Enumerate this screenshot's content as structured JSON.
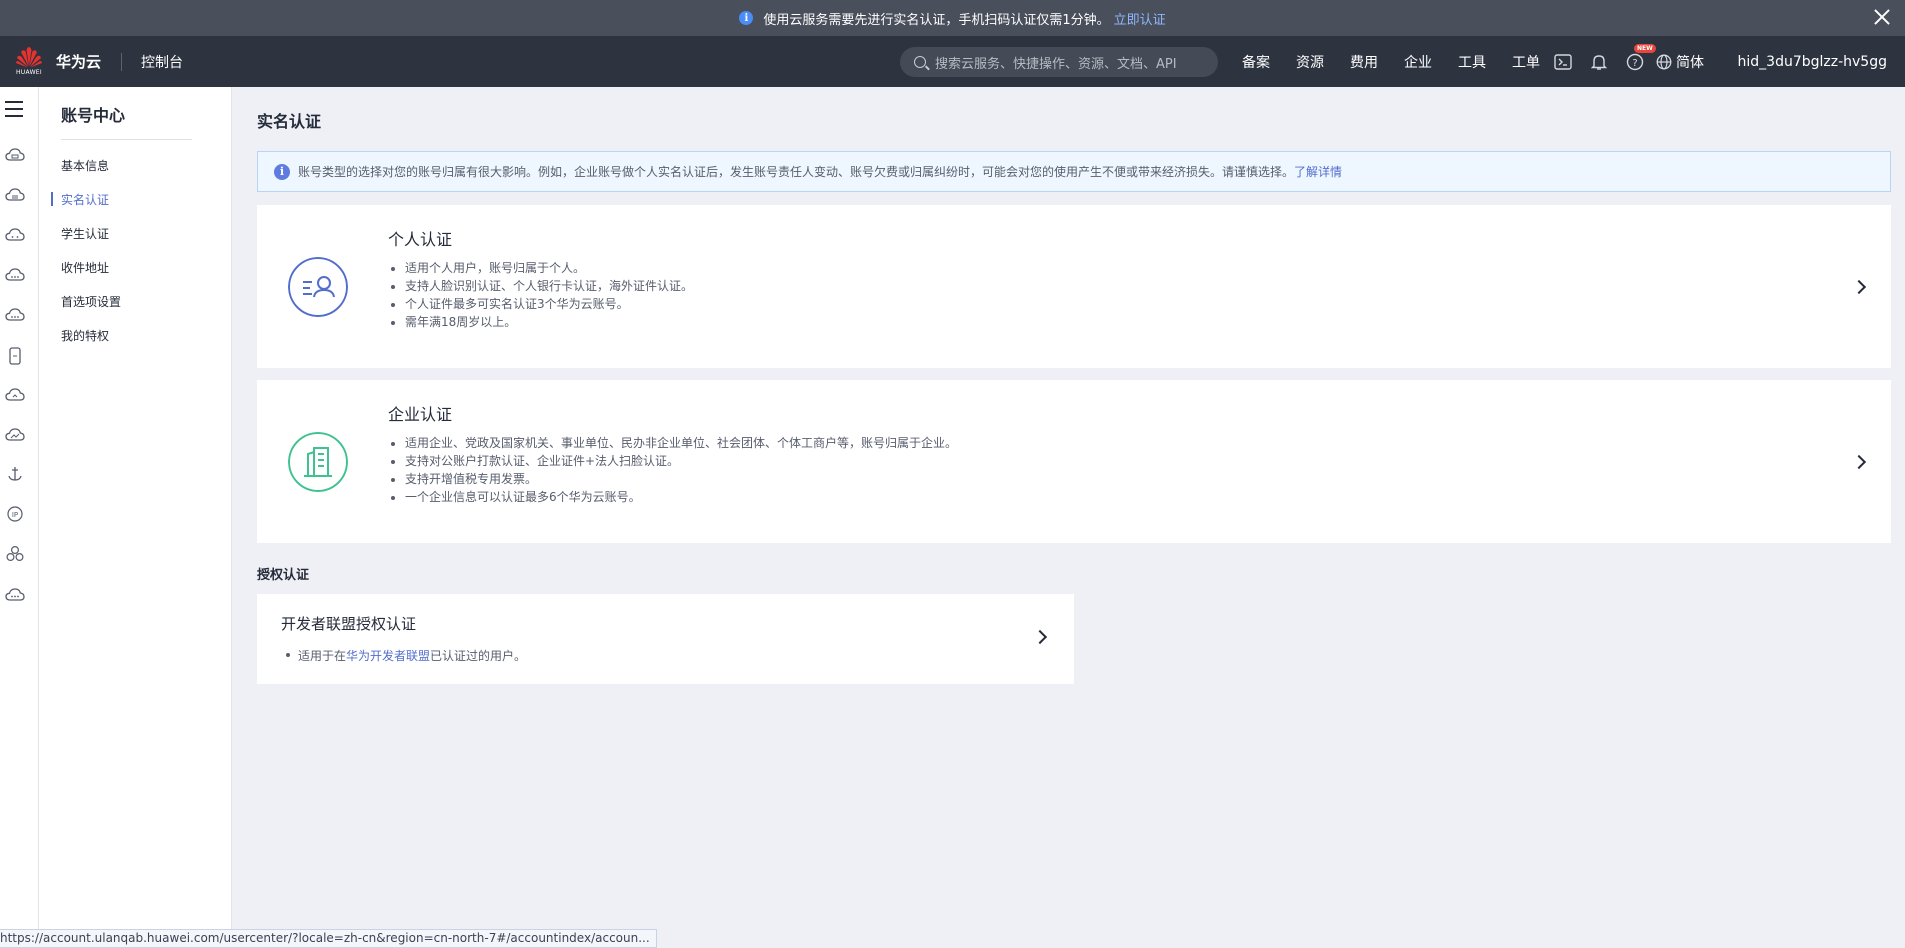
{
  "notice": {
    "text": "使用云服务需要先进行实名认证，手机扫码认证仅需1分钟。",
    "link": "立即认证"
  },
  "header": {
    "logo_text": "华为云",
    "logo_sub": "HUAWEI",
    "console": "控制台",
    "search_placeholder": "搜索云服务、快捷操作、资源、文档、API",
    "nav": [
      "备案",
      "资源",
      "费用",
      "企业",
      "工具",
      "工单"
    ],
    "new_badge": "NEW",
    "language": "简体",
    "user": "hid_3du7bglzz-hv5gg"
  },
  "menu": {
    "title": "账号中心",
    "items": [
      "基本信息",
      "实名认证",
      "学生认证",
      "收件地址",
      "首选项设置",
      "我的特权"
    ],
    "active_index": 1
  },
  "main": {
    "page_title": "实名认证",
    "alert_text": "账号类型的选择对您的账号归属有很大影响。例如，企业账号做个人实名认证后，发生账号责任人变动、账号欠费或归属纠纷时，可能会对您的使用产生不便或带来经济损失。请谨慎选择。",
    "alert_link": "了解详情",
    "personal": {
      "title": "个人认证",
      "bullets": [
        "适用个人用户，账号归属于个人。",
        "支持人脸识别认证、个人银行卡认证，海外证件认证。",
        "个人证件最多可实名认证3个华为云账号。",
        "需年满18周岁以上。"
      ],
      "icon_color": "#526ecc"
    },
    "enterprise": {
      "title": "企业认证",
      "bullets": [
        "适用企业、党政及国家机关、事业单位、民办非企业单位、社会团体、个体工商户等，账号归属于企业。",
        "支持对公账户打款认证、企业证件+法人扫脸认证。",
        "支持开增值税专用发票。",
        "一个企业信息可以认证最多6个华为云账号。"
      ],
      "icon_color": "#3ec28f"
    },
    "auth_section_title": "授权认证",
    "developer": {
      "title": "开发者联盟授权认证",
      "desc_prefix": "适用于在",
      "desc_link": "华为开发者联盟",
      "desc_suffix": "已认证过的用户。"
    }
  },
  "statusbar": {
    "url": "https://account.ulanqab.huawei.com/usercenter/?locale=zh-cn&region=cn-north-7#/accountindex/accoun..."
  }
}
